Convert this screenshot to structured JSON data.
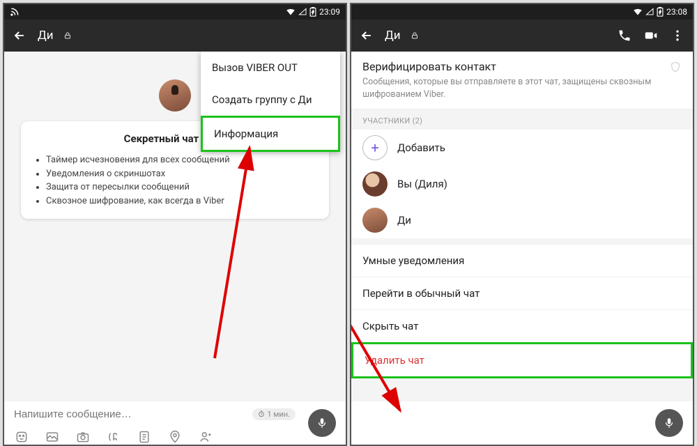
{
  "left": {
    "status_time": "23:09",
    "title": "Ди",
    "menu": {
      "item1": "Вызов VIBER OUT",
      "item2": "Создать группу с Ди",
      "item3": "Информация"
    },
    "card": {
      "heading": "Секретный чат с Ди:",
      "bullets": [
        "Таймер исчезновения для всех сообщений",
        "Уведомления о скриншотах",
        "Защита от пересылки сообщений",
        "Сквозное шифрование, как всегда в Viber"
      ]
    },
    "input": {
      "placeholder": "Напишите сообщение…",
      "timer": "1 мин."
    }
  },
  "right": {
    "status_time": "23:08",
    "title": "Ди",
    "verify": {
      "heading": "Верифицировать контакт",
      "sub": "Сообщения, которые вы отправляете в этот чат, защищены сквозным шифрованием Viber."
    },
    "participants": {
      "label": "УЧАСТНИКИ (2)",
      "add": "Добавить",
      "p1": "Вы (Диля)",
      "p2": "Ди"
    },
    "options": {
      "o1": "Умные уведомления",
      "o2": "Перейти в обычный чат",
      "o3": "Скрыть чат",
      "o4": "Удалить чат"
    }
  }
}
